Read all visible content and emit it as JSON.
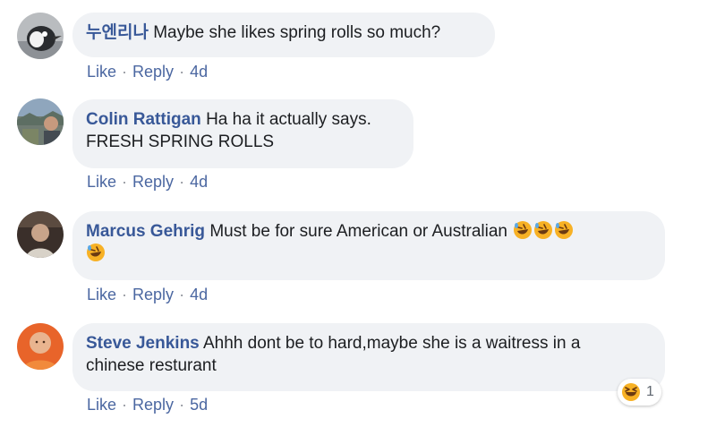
{
  "comments": [
    {
      "author": "누엔리나",
      "text": "Maybe she likes spring rolls so much?",
      "like": "Like",
      "reply": "Reply",
      "time": "4d",
      "avatar_icon": "penguin-avatar-icon"
    },
    {
      "author": "Colin Rattigan",
      "text": "Ha ha it actually says.",
      "text2": "FRESH SPRING ROLLS",
      "like": "Like",
      "reply": "Reply",
      "time": "4d",
      "avatar_icon": "landscape-avatar-icon"
    },
    {
      "author": "Marcus Gehrig",
      "text": "Must be for sure American or Australian",
      "like": "Like",
      "reply": "Reply",
      "time": "4d",
      "emoji": "rolling-on-floor-laughing",
      "emoji_count": 4,
      "avatar_icon": "man-avatar-icon"
    },
    {
      "author": "Steve Jenkins",
      "text": "Ahhh dont be to hard,maybe she is a waitress in a",
      "text2": "chinese resturant",
      "like": "Like",
      "reply": "Reply",
      "time": "5d",
      "reaction_icon": "haha-reaction",
      "reaction_count": "1",
      "avatar_icon": "man-orange-avatar-icon"
    }
  ],
  "colors": {
    "author": "#385898",
    "bubble": "#f0f2f5",
    "link": "#4b67a1",
    "emoji": "#f7b125"
  },
  "separator": "·"
}
